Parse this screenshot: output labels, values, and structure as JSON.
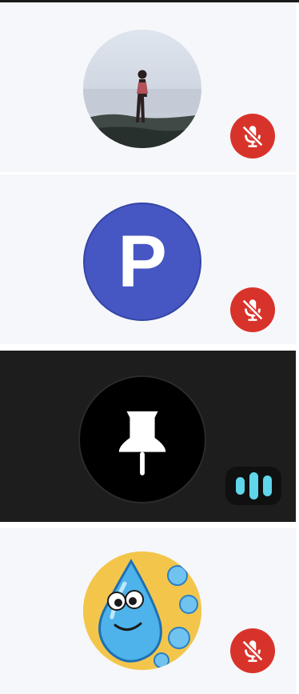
{
  "participants": [
    {
      "avatar_type": "photo",
      "avatar_icon": "person-silhouette-photo",
      "mic": "muted",
      "mic_icon": "mic-off-icon"
    },
    {
      "avatar_type": "initial",
      "initial": "P",
      "avatar_color": "#4657c3",
      "mic": "muted",
      "mic_icon": "mic-off-icon"
    },
    {
      "avatar_type": "icon",
      "avatar_icon": "pushpin-icon",
      "mic": "speaking",
      "mic_icon": "audio-level-icon",
      "tile_color": "#1d1d1d"
    },
    {
      "avatar_type": "photo",
      "avatar_icon": "water-drop-cartoon-photo",
      "mic": "muted",
      "mic_icon": "mic-off-icon"
    }
  ],
  "colors": {
    "muted_badge": "#d8332b",
    "speaking_bars": "#5fd6ea",
    "tile_background": "#f6f7fa"
  }
}
